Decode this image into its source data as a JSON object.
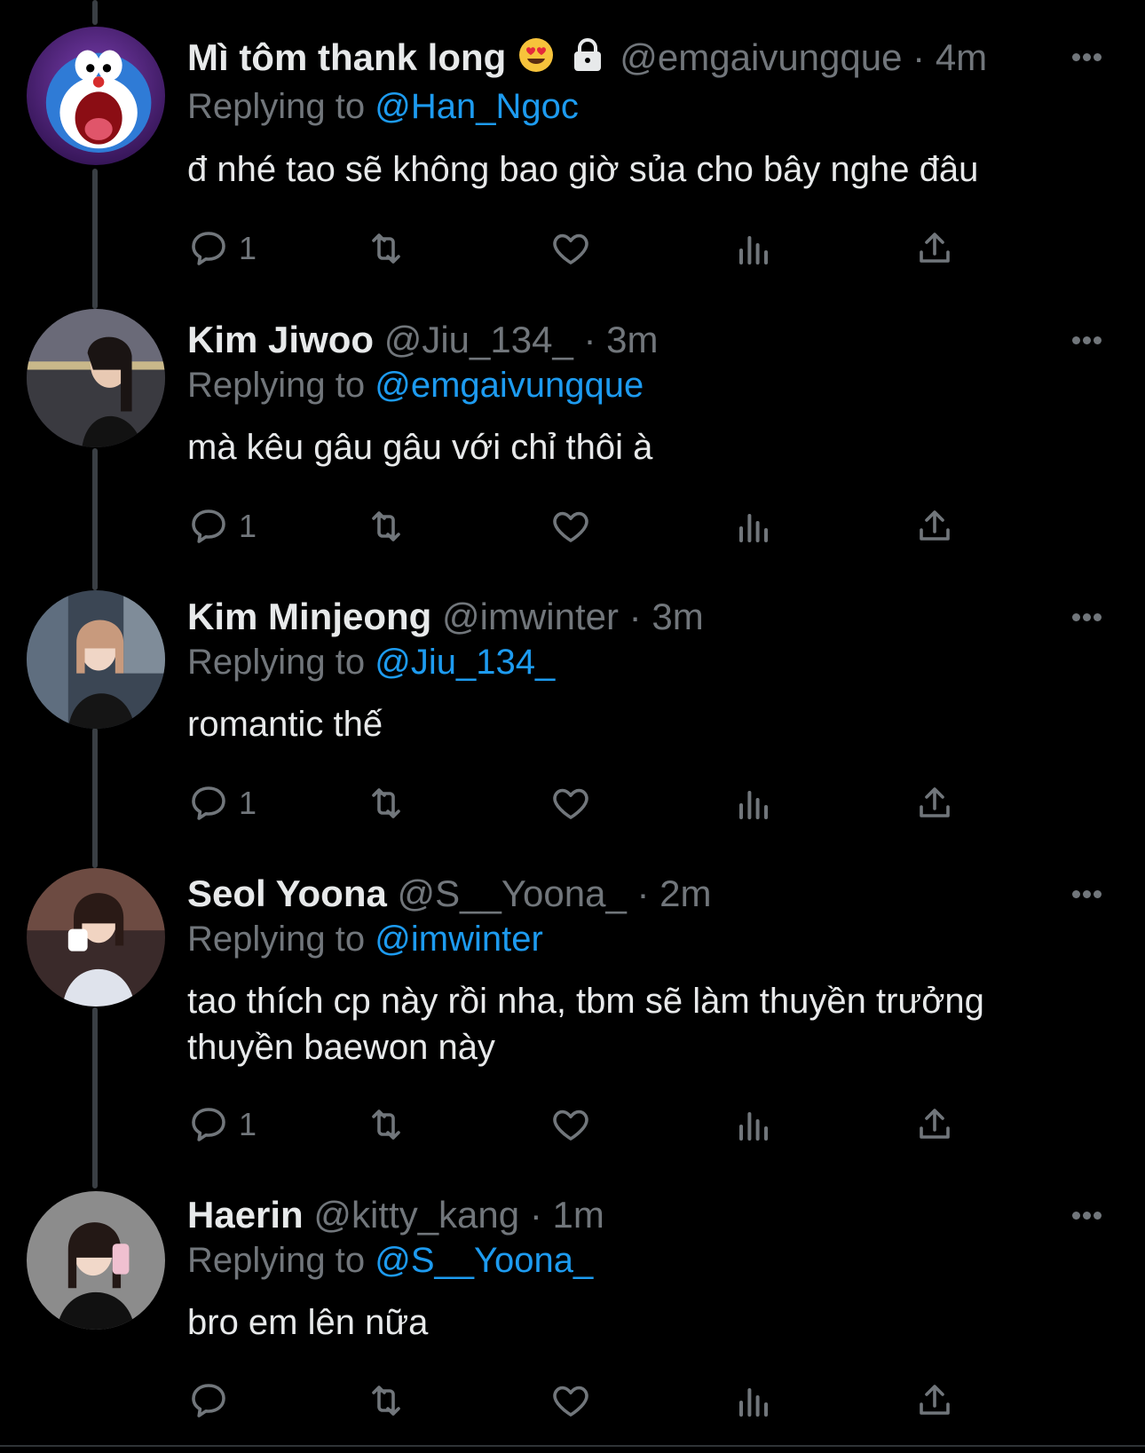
{
  "tweets": [
    {
      "name": "Mì tôm thank long",
      "handle": "@emgaivungque",
      "time": "4m",
      "replying_prefix": "Replying to",
      "replying_to": "@Han_Ngoc",
      "text": "đ nhé tao sẽ không bao giờ sủa cho bây nghe đâu",
      "reply_count": "1"
    },
    {
      "name": "Kim Jiwoo",
      "handle": "@Jiu_134_",
      "time": "3m",
      "replying_prefix": "Replying to",
      "replying_to": "@emgaivungque",
      "text": "mà kêu gâu gâu với chỉ thôi à",
      "reply_count": "1"
    },
    {
      "name": "Kim Minjeong",
      "handle": "@imwinter",
      "time": "3m",
      "replying_prefix": "Replying to",
      "replying_to": "@Jiu_134_",
      "text": "romantic thế",
      "reply_count": "1"
    },
    {
      "name": "Seol Yoona",
      "handle": "@S__Yoona_",
      "time": "2m",
      "replying_prefix": "Replying to",
      "replying_to": "@imwinter",
      "text": "tao thích cp này rồi nha, tbm sẽ làm thuyền trưởng thuyền baewon này",
      "reply_count": "1"
    },
    {
      "name": "Haerin",
      "handle": "@kitty_kang",
      "time": "1m",
      "replying_prefix": "Replying to",
      "replying_to": "@S__Yoona_",
      "text": "bro em lên nữa",
      "reply_count": ""
    }
  ],
  "separator": "·",
  "icons": {
    "reply": "reply-icon",
    "retweet": "retweet-icon",
    "like": "heart-icon",
    "views": "analytics-icon",
    "share": "share-icon",
    "more": "more-icon",
    "protected": "lock-icon",
    "emoji": "heart-eyes-emoji"
  },
  "colors": {
    "background": "#000000",
    "text": "#e7e9ea",
    "muted": "#71767b",
    "link": "#1d9bf0",
    "thread_line": "#3a3f44"
  }
}
